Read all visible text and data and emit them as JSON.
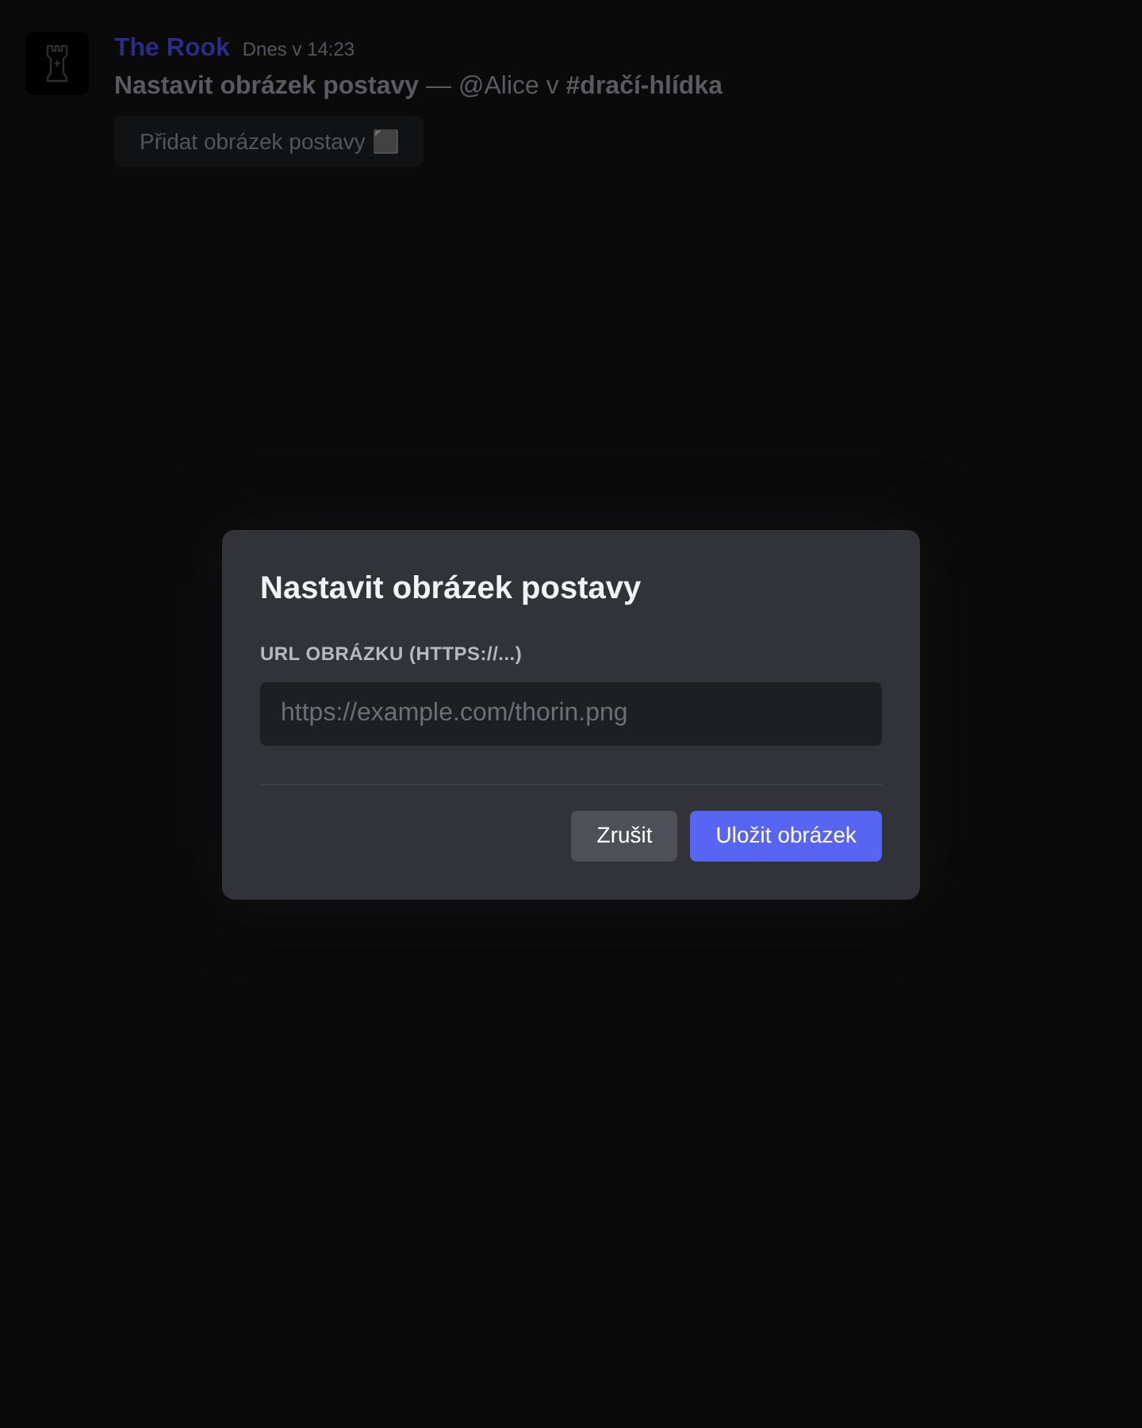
{
  "message": {
    "author": "The Rook",
    "timestamp": "Dnes v 14:23",
    "content": "**Nastavit obrázek postavy** — @Alice v **#dračí-hlídka**",
    "button": "Přidat obrázek postavy ⬛"
  },
  "dialog": {
    "title": "Nastavit obrázek postavy",
    "field": {
      "label": "URL OBRÁZKU (HTTPS://...)",
      "placeholder": "https://example.com/thorin.png"
    },
    "buttons": [
      {
        "label": "Zrušit",
        "kind": "secondary"
      },
      {
        "label": "Uložit obrázek",
        "kind": "primary"
      }
    ]
  }
}
